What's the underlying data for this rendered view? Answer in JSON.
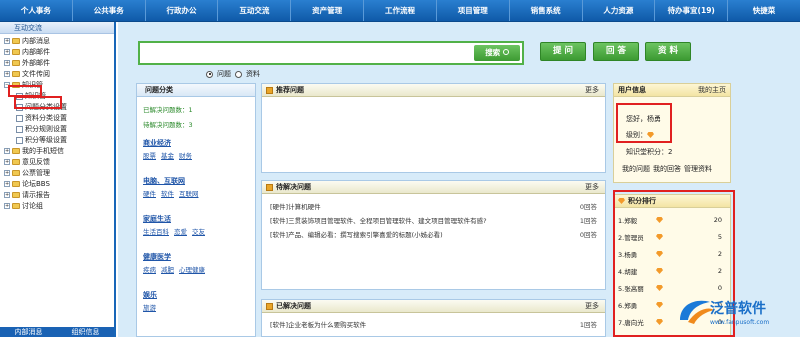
{
  "topnav": [
    "个人事务",
    "公共事务",
    "行政办公",
    "互动交流",
    "资产管理",
    "工作流程",
    "项目管理",
    "销售系统",
    "人力资源",
    "待办事宜(19)",
    "快捷菜"
  ],
  "sidebar": {
    "header": "互动交流",
    "items": [
      {
        "label": "内部消息",
        "level": 0,
        "type": "folder"
      },
      {
        "label": "内部邮件",
        "level": 0,
        "type": "folder"
      },
      {
        "label": "外部邮件",
        "level": 0,
        "type": "folder"
      },
      {
        "label": "文件传阅",
        "level": 0,
        "type": "folder"
      },
      {
        "label": "知识管",
        "level": 0,
        "type": "folder",
        "expanded": true
      },
      {
        "label": "知识管",
        "level": 1,
        "type": "doc"
      },
      {
        "label": "问题分类设置",
        "level": 1,
        "type": "doc"
      },
      {
        "label": "资料分类设置",
        "level": 1,
        "type": "doc"
      },
      {
        "label": "积分规则设置",
        "level": 1,
        "type": "doc"
      },
      {
        "label": "积分等级设置",
        "level": 1,
        "type": "doc"
      },
      {
        "label": "我的手机短信",
        "level": 0,
        "type": "folder"
      },
      {
        "label": "意见反馈",
        "level": 0,
        "type": "folder"
      },
      {
        "label": "公票管理",
        "level": 0,
        "type": "folder"
      },
      {
        "label": "论坛BBS",
        "level": 0,
        "type": "folder"
      },
      {
        "label": "请示报告",
        "level": 0,
        "type": "folder"
      },
      {
        "label": "讨论组",
        "level": 0,
        "type": "folder"
      }
    ],
    "footer": [
      "内部消息",
      "组织信息"
    ]
  },
  "search": {
    "button": "搜索",
    "value": "",
    "options": [
      "问题",
      "资料"
    ],
    "selected": "问题"
  },
  "actions": [
    "提 问",
    "回 答",
    "资 料"
  ],
  "categories": {
    "header": "问题分类",
    "resolved_label": "已解决问题数：",
    "resolved_count": "1",
    "pending_label": "待解决问题数：",
    "pending_count": "3",
    "groups": [
      {
        "title": "商业经济",
        "links": [
          "股票",
          "基金",
          "财务"
        ]
      },
      {
        "title": "电脑、互联网",
        "links": [
          "硬件",
          "软件",
          "互联网"
        ]
      },
      {
        "title": "家庭生活",
        "links": [
          "生活百科",
          "恋爱",
          "交友"
        ]
      },
      {
        "title": "健康医学",
        "links": [
          "疾病",
          "减肥",
          "心理健康"
        ]
      },
      {
        "title": "娱乐",
        "links": [
          "旅游"
        ]
      }
    ]
  },
  "recommended": {
    "header": "推荐问题",
    "more": "更多"
  },
  "pending": {
    "header": "待解决问题",
    "more": "更多",
    "rows": [
      {
        "text": "[硬件]计算机硬件",
        "count": "0回答"
      },
      {
        "text": "[软件]三贯装饰项目管理软件、全程项目管理软件、建文项目管理软件有感?",
        "count": "1回答"
      },
      {
        "text": "[软件]产品、编辑必看：撰写搜索引擎喜爱的标题(小姊必看)",
        "count": "0回答"
      }
    ]
  },
  "solved": {
    "header": "已解决问题",
    "more": "更多",
    "rows": [
      {
        "text": "[软件]企业老板为什么要购买软件",
        "count": "1回答"
      }
    ]
  },
  "userinfo": {
    "header": "用户信息",
    "home": "我的主页",
    "greeting": "您好，杨勇",
    "level_label": "级别：",
    "points": "知识堂积分：2",
    "links": [
      "我的问题",
      "我的回答",
      "管理资料"
    ]
  },
  "ranking": {
    "header": "积分排行",
    "rows": [
      {
        "rank": "1.",
        "name": "郑毅",
        "score": "20"
      },
      {
        "rank": "2.",
        "name": "管理员",
        "score": "5"
      },
      {
        "rank": "3.",
        "name": "杨勇",
        "score": "2"
      },
      {
        "rank": "4.",
        "name": "胡建",
        "score": "2"
      },
      {
        "rank": "5.",
        "name": "张高丽",
        "score": "0"
      },
      {
        "rank": "6.",
        "name": "郑勇",
        "score": "0"
      },
      {
        "rank": "7.",
        "name": "唐向光",
        "score": "0"
      }
    ]
  },
  "watermark": {
    "brand": "泛普软件",
    "url": "www.fanpusoft.com"
  },
  "colors": {
    "accent_blue": "#1766b8",
    "button_green": "#3c9a32",
    "highlight_red": "#e02020"
  }
}
